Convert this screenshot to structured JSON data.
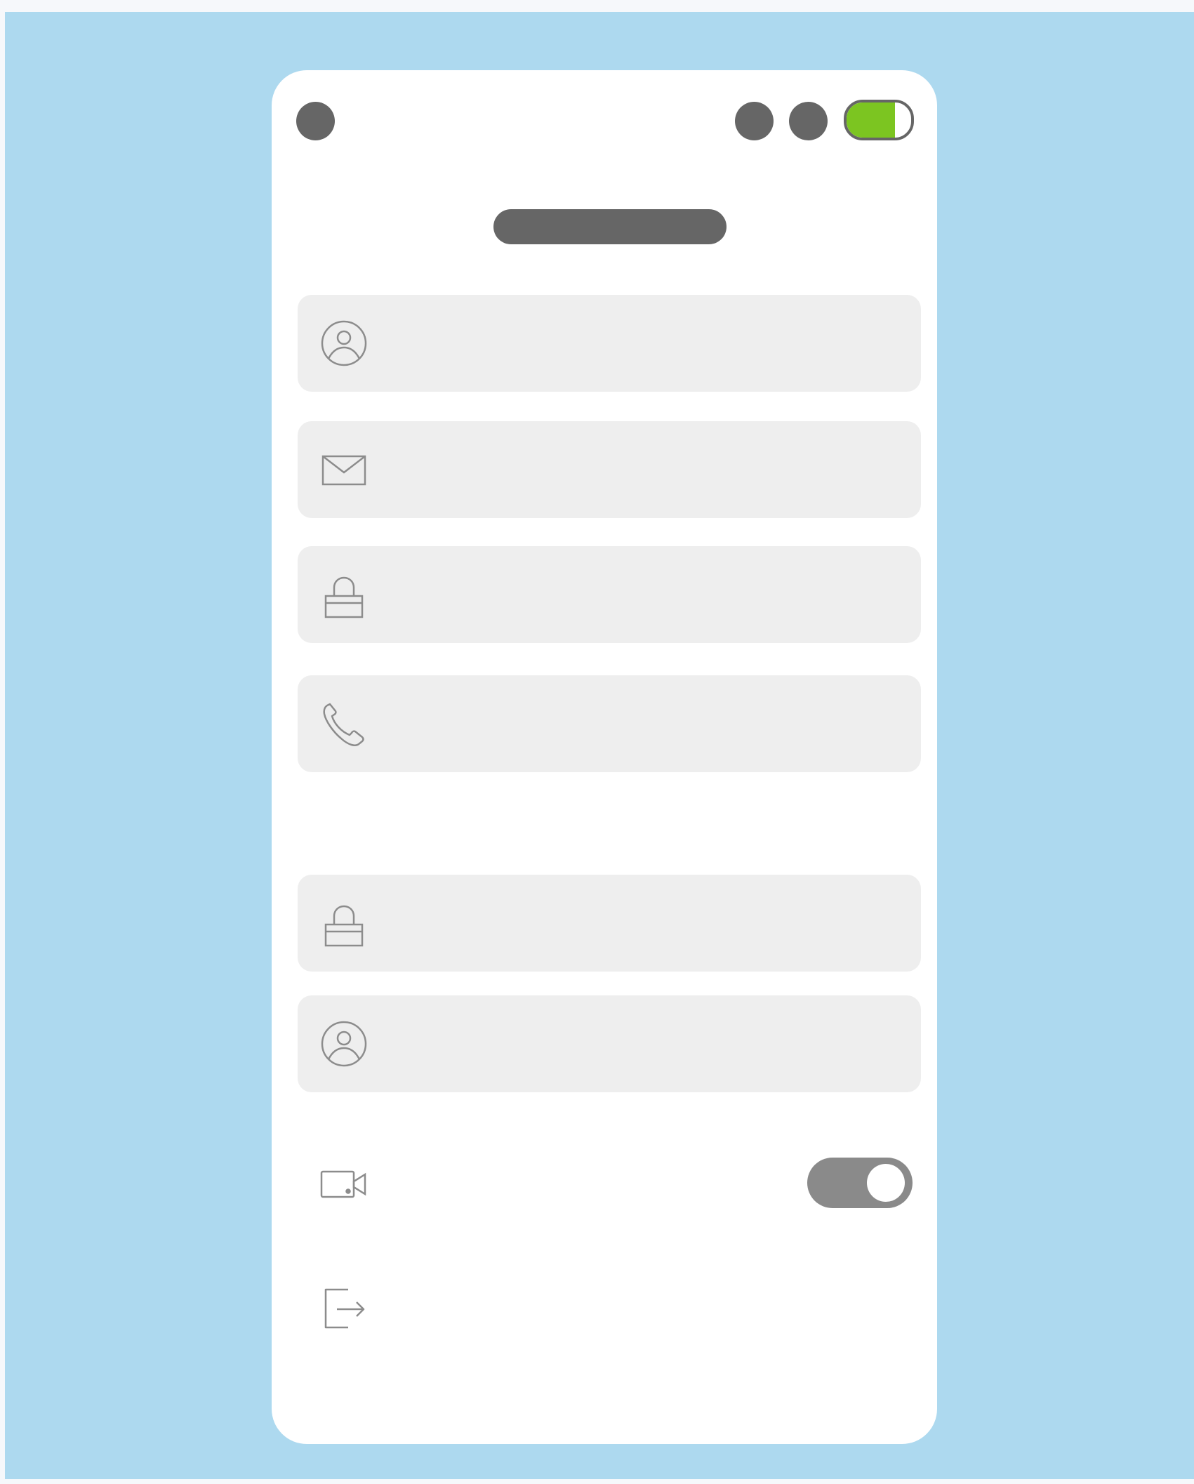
{
  "status_bar": {
    "battery_level": 0.75,
    "battery_color": "#7cc521"
  },
  "form": {
    "fields": [
      {
        "icon": "user-icon"
      },
      {
        "icon": "mail-icon"
      },
      {
        "icon": "lock-icon"
      },
      {
        "icon": "phone-icon"
      },
      {
        "icon": "lock-icon"
      },
      {
        "icon": "user-icon"
      }
    ]
  },
  "settings": {
    "video_toggle": {
      "icon": "video-camera-icon",
      "on": true
    },
    "logout": {
      "icon": "logout-icon"
    }
  },
  "colors": {
    "background": "#add9ef",
    "card": "#ffffff",
    "field": "#eeeeee",
    "placeholder_bars": "#666666",
    "icon_stroke": "#8c8c8c",
    "toggle_track": "#8a8a8a"
  }
}
